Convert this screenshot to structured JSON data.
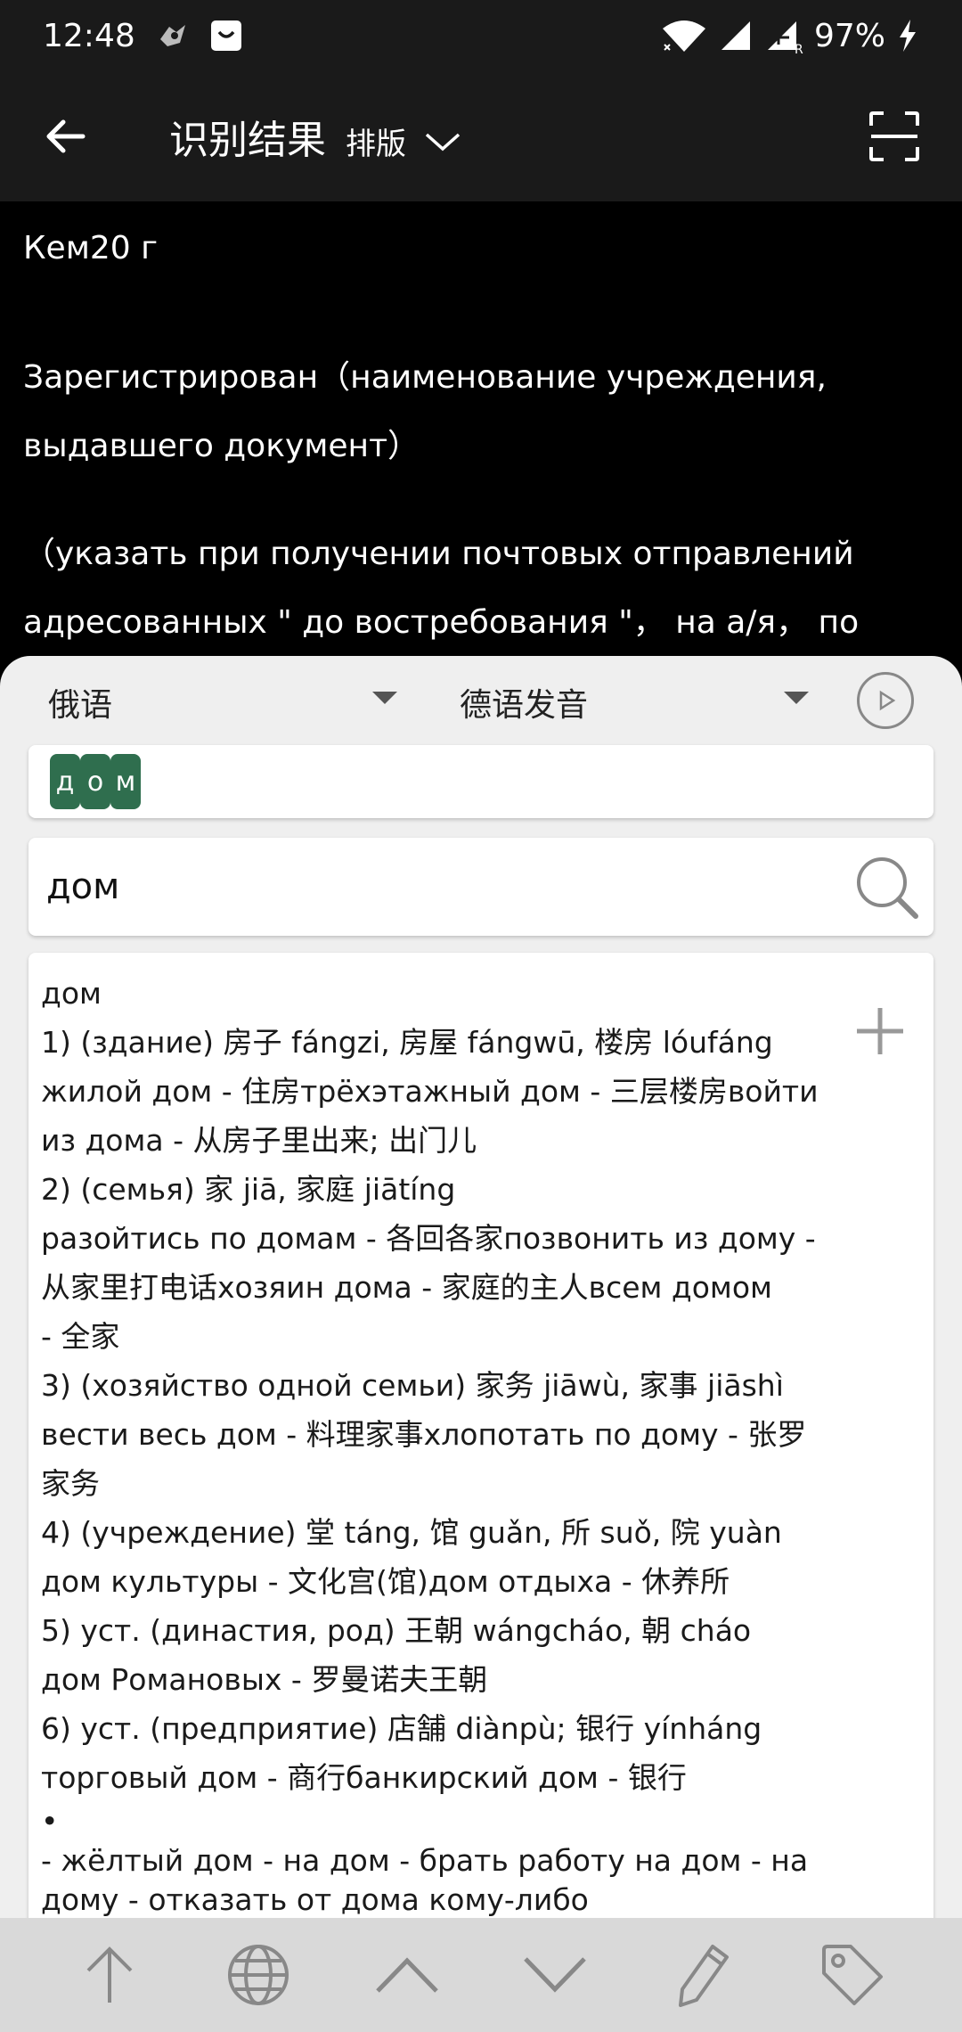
{
  "status": {
    "time": "12:48",
    "battery": "97%"
  },
  "toolbar": {
    "title": "识别结果",
    "layout_label": "排版"
  },
  "ocr": {
    "paragraphs": [
      [
        "Кем20 г"
      ],
      [
        "Зарегистрирован（наименование учреждения,",
        "выдавшего документ）"
      ],
      [
        "（указать при получении почтовых отправлений",
        "адресованных \" до востребования \"， на а/я， по"
      ]
    ]
  },
  "languages": {
    "source": "俄语",
    "target": "德语发音"
  },
  "tokens": [
    "д",
    "о",
    "м"
  ],
  "search": {
    "value": "дом"
  },
  "result": {
    "lines": [
      "дом",
      "1) (здание) 房子 fángzi, 房屋 fángwū, 楼房 lóufáng",
      "жилой дом - 住房трёхэтажный дом - 三层楼房войти",
      "из дома - 从房子里出来; 出门儿",
      "2) (семья) 家 jiā, 家庭 jiātíng",
      "разойтись по домам - 各回各家позвонить из дому -",
      "从家里打电话хозяин дома - 家庭的主人всем домом",
      "- 全家",
      "3) (хозяйство одной семьи) 家务 jiāwù, 家事 jiāshì",
      "вести весь дом - 料理家事хлопотать по дому - 张罗",
      "家务",
      "4) (учреждение) 堂 táng, 馆 guǎn, 所 suǒ, 院 yuàn",
      "дом культуры - 文化宫(馆)дом отдыха - 休养所",
      "5) уст. (династия, род) 王朝 wángcháo, 朝 cháo",
      "дом Романовых - 罗曼诺夫王朝",
      "6) уст. (предприятие) 店舗 diànpù; 银行 yínháng",
      "торговый дом - 商行банкирский дом - 银行",
      "•",
      "- жёлтый дом - на дом - брать работу на дом - на",
      "дому - отказать от дома кому-либо"
    ]
  },
  "colors": {
    "bar_bg": "#1a1a1a",
    "token_bg": "#2f6e4e",
    "panel_bg": "#efefef",
    "nav_bg": "#d9d9d9"
  }
}
